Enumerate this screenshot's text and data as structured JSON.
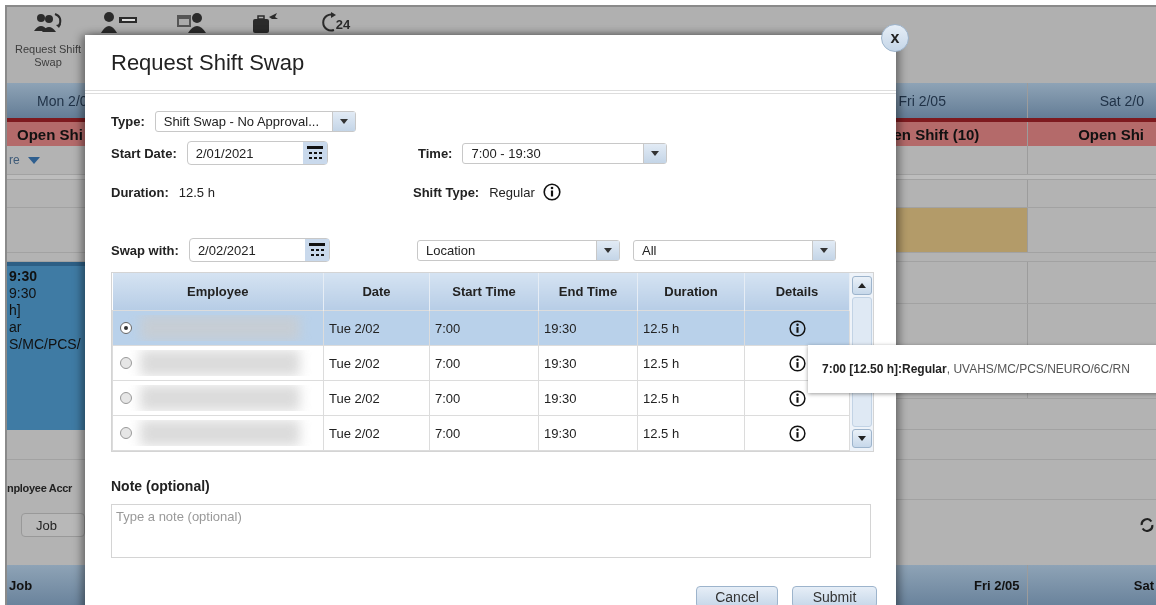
{
  "toolbar": {
    "items": [
      {
        "kind": "people-swap",
        "label": "Request Shift Swap"
      },
      {
        "kind": "person-bar"
      },
      {
        "kind": "calendar-person"
      },
      {
        "kind": "luggage"
      },
      {
        "kind": "clock",
        "badge": "24"
      }
    ]
  },
  "schedule": {
    "left": {
      "day": "Mon 2/0",
      "open_shift": "Open Shi",
      "filter": "re",
      "shift": {
        "title": "9:30",
        "lines": [
          "9:30",
          "h]",
          "ar",
          "S/MC/PCS/"
        ]
      },
      "section": "nployee Accr",
      "job_select": "Job",
      "footer": "Job"
    },
    "right": {
      "days": [
        "Fri 2/05",
        "Sat 2/0"
      ],
      "open_shifts": [
        "en Shift (10)",
        "Open Shi"
      ],
      "footer_days": [
        "Fri 2/05",
        "Sat"
      ]
    }
  },
  "dialog": {
    "title": "Request Shift Swap",
    "close": "x",
    "form": {
      "type": {
        "label": "Type:",
        "value": "Shift Swap - No Approval..."
      },
      "start_date": {
        "label": "Start Date:",
        "value": "2/01/2021"
      },
      "time": {
        "label": "Time:",
        "value": "7:00 - 19:30"
      },
      "duration": {
        "label": "Duration:",
        "value": "12.5 h"
      },
      "shift_type": {
        "label": "Shift Type:",
        "value": "Regular"
      },
      "swap_with": {
        "label": "Swap with:",
        "value": "2/02/2021"
      },
      "location": {
        "value": "Location"
      },
      "scope": {
        "value": "All"
      }
    },
    "table": {
      "columns": [
        "Employee",
        "Date",
        "Start Time",
        "End Time",
        "Duration",
        "Details"
      ],
      "rows": [
        {
          "selected": true,
          "date": "Tue 2/02",
          "start": "7:00",
          "end": "19:30",
          "duration": "12.5 h"
        },
        {
          "selected": false,
          "date": "Tue 2/02",
          "start": "7:00",
          "end": "19:30",
          "duration": "12.5 h"
        },
        {
          "selected": false,
          "date": "Tue 2/02",
          "start": "7:00",
          "end": "19:30",
          "duration": "12.5 h"
        },
        {
          "selected": false,
          "date": "Tue 2/02",
          "start": "7:00",
          "end": "19:30",
          "duration": "12.5 h"
        }
      ]
    },
    "note": {
      "label": "Note (optional)",
      "placeholder": "Type a note (optional)"
    },
    "buttons": [
      {
        "label": "Cancel"
      },
      {
        "label": "Submit"
      }
    ]
  },
  "tooltip": "**7:00 [12.50 h]:Regular**, UVAHS/MC/PCS/NEURO/6C/RN"
}
